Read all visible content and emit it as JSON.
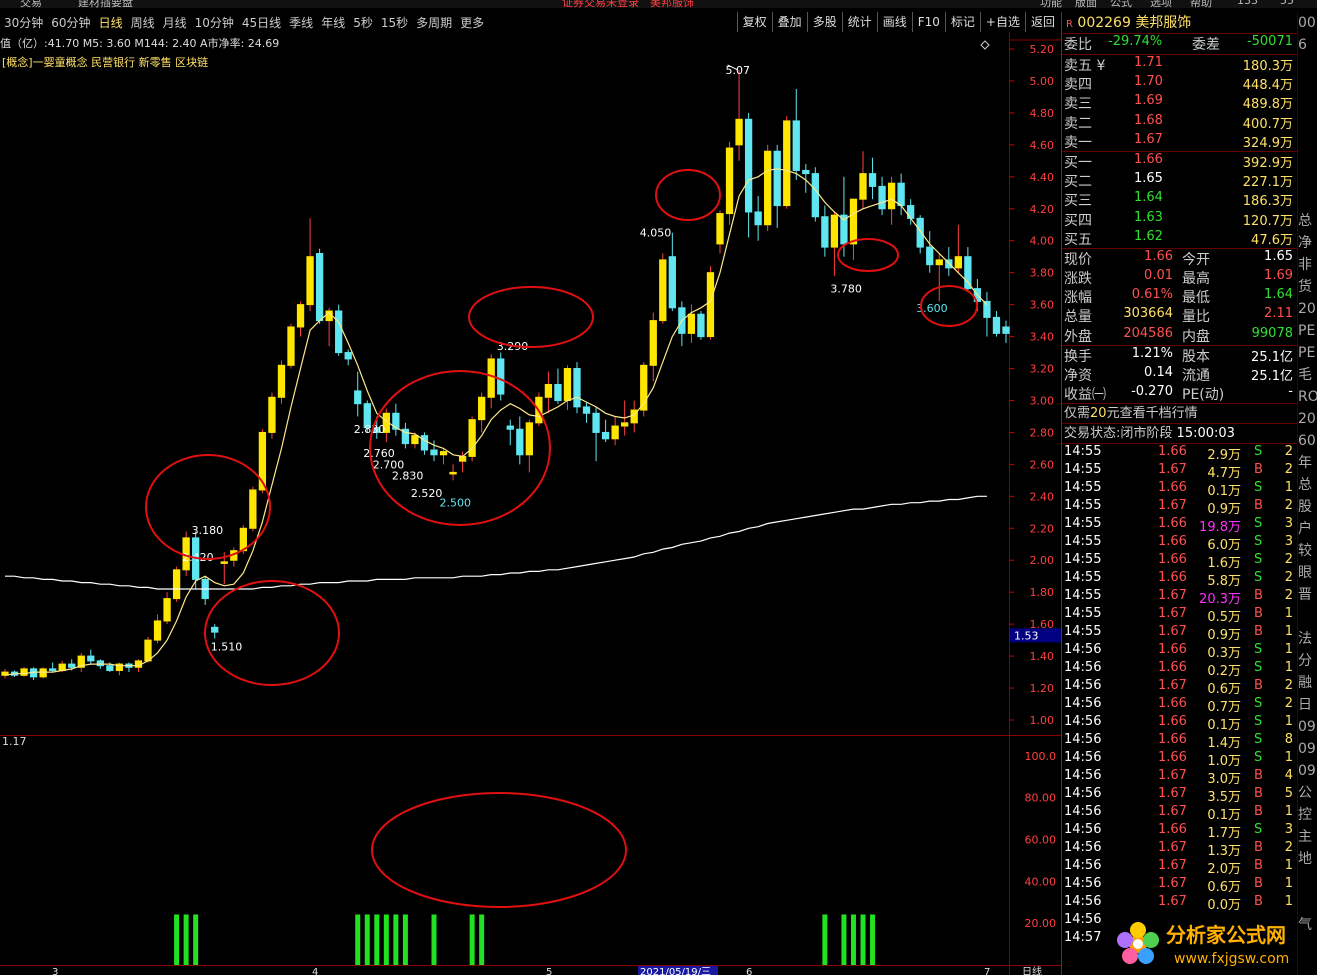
{
  "top_menu": [
    "交易",
    "建材插要盘",
    "证券交易未登录",
    "美邦服饰",
    "功能",
    "版面",
    "公式",
    "选项",
    "帮助",
    "133",
    "55"
  ],
  "periods": [
    "30分钟",
    "60分钟",
    "日线",
    "周线",
    "月线",
    "10分钟",
    "45日线",
    "季线",
    "年线",
    "5秒",
    "15秒",
    "多周期",
    "更多"
  ],
  "active_period": "日线",
  "tools": [
    "复权",
    "叠加",
    "多股",
    "统计",
    "画线",
    "F10",
    "标记",
    "+自选",
    "返回"
  ],
  "info_line": "值（亿）:41.70  M5: 3.60  M144: 2.40  A市净率: 24.69",
  "concepts": "[概念]一婴童概念 民营银行 新零售 区块链",
  "chart_data": {
    "type": "candlestick",
    "ylim": [
      0.95,
      5.3
    ],
    "yticks": [
      "5.20",
      "5.00",
      "4.80",
      "4.60",
      "4.40",
      "4.20",
      "4.00",
      "3.80",
      "3.60",
      "3.40",
      "3.20",
      "3.00",
      "2.80",
      "2.60",
      "2.40",
      "2.20",
      "2.00",
      "1.80",
      "1.60",
      "1.40",
      "1.20",
      "1.00"
    ],
    "current_price_tag": "1.53",
    "top_left_value": "1.17",
    "x_tick_labels": [
      "3",
      "4",
      "5",
      "2021/05/19/三",
      "6",
      "7",
      "日线"
    ],
    "candles": [
      [
        1.28,
        1.32,
        1.26,
        1.3
      ],
      [
        1.3,
        1.31,
        1.27,
        1.28
      ],
      [
        1.28,
        1.33,
        1.27,
        1.32
      ],
      [
        1.32,
        1.33,
        1.25,
        1.27
      ],
      [
        1.27,
        1.33,
        1.26,
        1.32
      ],
      [
        1.32,
        1.36,
        1.3,
        1.31
      ],
      [
        1.31,
        1.37,
        1.3,
        1.35
      ],
      [
        1.35,
        1.38,
        1.31,
        1.33
      ],
      [
        1.33,
        1.42,
        1.3,
        1.4
      ],
      [
        1.4,
        1.44,
        1.35,
        1.37
      ],
      [
        1.37,
        1.38,
        1.32,
        1.34
      ],
      [
        1.34,
        1.36,
        1.3,
        1.31
      ],
      [
        1.31,
        1.36,
        1.28,
        1.35
      ],
      [
        1.35,
        1.36,
        1.3,
        1.33
      ],
      [
        1.33,
        1.38,
        1.3,
        1.37
      ],
      [
        1.37,
        1.52,
        1.36,
        1.5
      ],
      [
        1.5,
        1.66,
        1.48,
        1.62
      ],
      [
        1.62,
        1.8,
        1.6,
        1.76
      ],
      [
        1.76,
        1.96,
        1.74,
        1.94
      ],
      [
        1.94,
        2.18,
        1.9,
        2.14
      ],
      [
        2.14,
        2.18,
        1.82,
        1.88
      ],
      [
        1.88,
        1.9,
        1.72,
        1.76
      ],
      [
        1.58,
        1.6,
        1.51,
        1.55
      ],
      [
        1.98,
        2.05,
        1.85,
        1.99
      ],
      [
        2.0,
        2.08,
        1.96,
        2.06
      ],
      [
        2.06,
        2.22,
        2.04,
        2.2
      ],
      [
        2.2,
        2.46,
        2.18,
        2.44
      ],
      [
        2.44,
        2.82,
        2.42,
        2.8
      ],
      [
        2.8,
        3.05,
        2.76,
        3.02
      ],
      [
        3.02,
        3.25,
        2.98,
        3.22
      ],
      [
        3.22,
        3.48,
        3.2,
        3.46
      ],
      [
        3.46,
        3.62,
        3.4,
        3.6
      ],
      [
        3.6,
        4.14,
        3.56,
        3.9
      ],
      [
        3.92,
        3.95,
        3.48,
        3.5
      ],
      [
        3.5,
        3.58,
        3.34,
        3.56
      ],
      [
        3.56,
        3.6,
        3.28,
        3.3
      ],
      [
        3.3,
        3.32,
        3.22,
        3.26
      ],
      [
        3.06,
        3.18,
        2.9,
        2.98
      ],
      [
        2.98,
        3.0,
        2.8,
        2.83
      ],
      [
        2.83,
        2.9,
        2.76,
        2.8
      ],
      [
        2.8,
        2.95,
        2.74,
        2.92
      ],
      [
        2.92,
        2.98,
        2.78,
        2.82
      ],
      [
        2.82,
        2.86,
        2.7,
        2.73
      ],
      [
        2.73,
        2.8,
        2.7,
        2.78
      ],
      [
        2.78,
        2.8,
        2.66,
        2.69
      ],
      [
        2.69,
        2.75,
        2.62,
        2.66
      ],
      [
        2.66,
        2.7,
        2.6,
        2.68
      ],
      [
        2.54,
        2.6,
        2.5,
        2.55
      ],
      [
        2.62,
        2.68,
        2.55,
        2.65
      ],
      [
        2.65,
        2.9,
        2.62,
        2.88
      ],
      [
        2.88,
        3.05,
        2.8,
        3.02
      ],
      [
        3.02,
        3.29,
        2.95,
        3.26
      ],
      [
        3.26,
        3.3,
        3.0,
        3.04
      ],
      [
        2.84,
        2.88,
        2.72,
        2.82
      ],
      [
        2.82,
        2.9,
        2.6,
        2.66
      ],
      [
        2.66,
        2.88,
        2.55,
        2.86
      ],
      [
        2.86,
        3.05,
        2.84,
        3.02
      ],
      [
        3.02,
        3.18,
        2.92,
        3.1
      ],
      [
        3.1,
        3.2,
        2.98,
        3.0
      ],
      [
        3.0,
        3.22,
        2.94,
        3.2
      ],
      [
        3.2,
        3.24,
        2.92,
        2.96
      ],
      [
        2.96,
        2.99,
        2.86,
        2.92
      ],
      [
        2.92,
        2.96,
        2.62,
        2.8
      ],
      [
        2.8,
        2.88,
        2.74,
        2.76
      ],
      [
        2.76,
        2.9,
        2.72,
        2.84
      ],
      [
        2.84,
        3.0,
        2.78,
        2.86
      ],
      [
        2.86,
        3.0,
        2.8,
        2.94
      ],
      [
        2.94,
        3.24,
        2.9,
        3.22
      ],
      [
        3.22,
        3.55,
        3.12,
        3.5
      ],
      [
        3.5,
        3.92,
        3.48,
        3.88
      ],
      [
        3.9,
        4.05,
        3.56,
        3.58
      ],
      [
        3.58,
        3.62,
        3.34,
        3.42
      ],
      [
        3.42,
        3.6,
        3.36,
        3.54
      ],
      [
        3.54,
        3.56,
        3.38,
        3.4
      ],
      [
        3.4,
        3.84,
        3.38,
        3.8
      ],
      [
        3.98,
        4.19,
        3.92,
        4.17
      ],
      [
        4.17,
        4.62,
        4.1,
        4.58
      ],
      [
        4.6,
        5.07,
        4.5,
        4.76
      ],
      [
        4.76,
        4.8,
        4.02,
        4.18
      ],
      [
        4.18,
        4.28,
        4.0,
        4.1
      ],
      [
        4.1,
        4.6,
        4.06,
        4.56
      ],
      [
        4.56,
        4.6,
        4.08,
        4.22
      ],
      [
        4.22,
        4.78,
        4.2,
        4.75
      ],
      [
        4.75,
        4.95,
        4.38,
        4.44
      ],
      [
        4.44,
        4.48,
        4.3,
        4.42
      ],
      [
        4.42,
        4.46,
        4.12,
        4.15
      ],
      [
        4.15,
        4.22,
        3.9,
        3.96
      ],
      [
        3.96,
        4.18,
        3.78,
        4.16
      ],
      [
        4.16,
        4.4,
        3.9,
        3.98
      ],
      [
        3.98,
        4.1,
        3.88,
        4.26
      ],
      [
        4.26,
        4.56,
        4.2,
        4.42
      ],
      [
        4.42,
        4.52,
        4.26,
        4.34
      ],
      [
        4.34,
        4.4,
        4.16,
        4.2
      ],
      [
        4.2,
        4.4,
        4.1,
        4.36
      ],
      [
        4.36,
        4.42,
        4.16,
        4.22
      ],
      [
        4.22,
        4.26,
        4.1,
        4.14
      ],
      [
        4.14,
        4.16,
        3.92,
        3.96
      ],
      [
        3.96,
        4.06,
        3.8,
        3.85
      ],
      [
        3.85,
        3.92,
        3.62,
        3.88
      ],
      [
        3.88,
        3.96,
        3.78,
        3.83
      ],
      [
        3.83,
        4.1,
        3.8,
        3.9
      ],
      [
        3.9,
        3.96,
        3.68,
        3.7
      ],
      [
        3.7,
        3.76,
        3.56,
        3.62
      ],
      [
        3.62,
        3.68,
        3.4,
        3.52
      ],
      [
        3.52,
        3.56,
        3.4,
        3.42
      ],
      [
        3.46,
        3.5,
        3.36,
        3.42
      ]
    ],
    "ma_short": [
      1.28,
      1.29,
      1.29,
      1.3,
      1.3,
      1.3,
      1.31,
      1.32,
      1.34,
      1.35,
      1.35,
      1.35,
      1.34,
      1.34,
      1.34,
      1.37,
      1.42,
      1.5,
      1.62,
      1.77,
      1.87,
      1.9,
      1.86,
      1.84,
      1.85,
      1.92,
      2.06,
      2.24,
      2.47,
      2.7,
      2.96,
      3.2,
      3.44,
      3.5,
      3.55,
      3.49,
      3.36,
      3.22,
      3.06,
      2.92,
      2.87,
      2.83,
      2.8,
      2.79,
      2.75,
      2.72,
      2.7,
      2.66,
      2.65,
      2.7,
      2.78,
      2.88,
      2.94,
      2.98,
      2.95,
      2.91,
      2.9,
      2.93,
      2.96,
      3.0,
      3.02,
      2.99,
      2.96,
      2.92,
      2.9,
      2.89,
      2.91,
      2.98,
      3.08,
      3.24,
      3.4,
      3.5,
      3.55,
      3.58,
      3.62,
      3.8,
      4.04,
      4.28,
      4.38,
      4.4,
      4.44,
      4.45,
      4.44,
      4.42,
      4.38,
      4.32,
      4.24,
      4.18,
      4.13,
      4.17,
      4.2,
      4.22,
      4.24,
      4.26,
      4.22,
      4.14,
      4.06,
      3.98,
      3.92,
      3.86,
      3.8,
      3.74,
      3.66,
      3.6
    ],
    "ma_long": [
      1.9,
      1.9,
      1.89,
      1.89,
      1.88,
      1.88,
      1.87,
      1.87,
      1.86,
      1.86,
      1.85,
      1.85,
      1.84,
      1.84,
      1.83,
      1.83,
      1.82,
      1.82,
      1.82,
      1.82,
      1.82,
      1.82,
      1.82,
      1.82,
      1.82,
      1.82,
      1.82,
      1.83,
      1.83,
      1.84,
      1.84,
      1.85,
      1.85,
      1.86,
      1.86,
      1.86,
      1.87,
      1.87,
      1.87,
      1.88,
      1.88,
      1.88,
      1.88,
      1.89,
      1.89,
      1.89,
      1.89,
      1.89,
      1.9,
      1.9,
      1.9,
      1.91,
      1.91,
      1.92,
      1.92,
      1.93,
      1.93,
      1.94,
      1.94,
      1.95,
      1.96,
      1.97,
      1.98,
      1.99,
      2.0,
      2.01,
      2.02,
      2.04,
      2.05,
      2.07,
      2.08,
      2.1,
      2.11,
      2.12,
      2.14,
      2.15,
      2.17,
      2.18,
      2.2,
      2.21,
      2.23,
      2.24,
      2.25,
      2.26,
      2.27,
      2.28,
      2.29,
      2.3,
      2.31,
      2.32,
      2.32,
      2.33,
      2.34,
      2.35,
      2.35,
      2.36,
      2.36,
      2.37,
      2.37,
      2.38,
      2.38,
      2.39,
      2.4,
      2.4
    ],
    "annotations": [
      {
        "label": "1.510",
        "candle": 22,
        "price": 1.46
      },
      {
        "label": "3.180",
        "candle": 20,
        "price": 2.19
      },
      {
        "label": "2.420",
        "candle": 19,
        "price": 2.02
      },
      {
        "label": "2.830",
        "candle": 37,
        "price": 2.82
      },
      {
        "label": "2.760",
        "candle": 38,
        "price": 2.67
      },
      {
        "label": "2.700",
        "candle": 39,
        "price": 2.6
      },
      {
        "label": "2.830",
        "candle": 41,
        "price": 2.53
      },
      {
        "label": "2.520",
        "candle": 43,
        "price": 2.42
      },
      {
        "label": "2.500",
        "candle": 46,
        "price": 2.36
      },
      {
        "label": "3.290",
        "candle": 52,
        "price": 3.34
      },
      {
        "label": "4.050",
        "candle": 67,
        "price": 4.05
      },
      {
        "label": "5.07",
        "candle": 76,
        "price": 5.07
      },
      {
        "label": "3.780",
        "candle": 87,
        "price": 3.7
      },
      {
        "label": "3.600",
        "candle": 96,
        "price": 3.58
      }
    ],
    "circles": [
      {
        "cx": 208,
        "cy": 507,
        "rx": 62,
        "ry": 52
      },
      {
        "cx": 272,
        "cy": 633,
        "rx": 67,
        "ry": 52
      },
      {
        "cx": 460,
        "cy": 448,
        "rx": 90,
        "ry": 77
      },
      {
        "cx": 531,
        "cy": 317,
        "rx": 62,
        "ry": 30
      },
      {
        "cx": 688,
        "cy": 195,
        "rx": 32,
        "ry": 25
      },
      {
        "cx": 868,
        "cy": 255,
        "rx": 30,
        "ry": 16
      },
      {
        "cx": 949,
        "cy": 306,
        "rx": 28,
        "ry": 20
      }
    ],
    "sub_yticks": [
      "100.0",
      "80.00",
      "60.00",
      "40.00",
      "20.00"
    ],
    "sub_ylim": [
      0,
      110
    ],
    "sub_bars": [
      {
        "candle": 18,
        "value": 50
      },
      {
        "candle": 19,
        "value": 50
      },
      {
        "candle": 20,
        "value": 50
      },
      {
        "candle": 37,
        "value": 50
      },
      {
        "candle": 38,
        "value": 50
      },
      {
        "candle": 39,
        "value": 50
      },
      {
        "candle": 40,
        "value": 50
      },
      {
        "candle": 41,
        "value": 50
      },
      {
        "candle": 42,
        "value": 50
      },
      {
        "candle": 45,
        "value": 50
      },
      {
        "candle": 49,
        "value": 50
      },
      {
        "candle": 50,
        "value": 50
      },
      {
        "candle": 86,
        "value": 50
      },
      {
        "candle": 88,
        "value": 50
      },
      {
        "candle": 89,
        "value": 50
      },
      {
        "candle": 90,
        "value": 50
      },
      {
        "candle": 91,
        "value": 50
      }
    ],
    "sub_circle": {
      "cx": 499,
      "cy": 850,
      "rx": 127,
      "ry": 57
    }
  },
  "stock": {
    "marker": "R",
    "code": "002269",
    "name": "美邦服饰"
  },
  "committee": {
    "label1": "委比",
    "val1": "-29.74%",
    "label2": "委差",
    "val2": "-50071"
  },
  "asks": [
    {
      "label": "卖五 ¥",
      "price": "1.71",
      "vol": "180.3万"
    },
    {
      "label": "卖四",
      "price": "1.70",
      "vol": "448.4万"
    },
    {
      "label": "卖三",
      "price": "1.69",
      "vol": "489.8万"
    },
    {
      "label": "卖二",
      "price": "1.68",
      "vol": "400.7万"
    },
    {
      "label": "卖一",
      "price": "1.67",
      "vol": "324.9万"
    }
  ],
  "bids": [
    {
      "label": "买一",
      "price": "1.66",
      "vol": "392.9万",
      "pc": "red"
    },
    {
      "label": "买二",
      "price": "1.65",
      "vol": "227.1万",
      "pc": "wht"
    },
    {
      "label": "买三",
      "price": "1.64",
      "vol": "186.3万",
      "pc": "grn"
    },
    {
      "label": "买四",
      "price": "1.63",
      "vol": "120.7万",
      "pc": "grn"
    },
    {
      "label": "买五",
      "price": "1.62",
      "vol": "47.6万",
      "pc": "grn"
    }
  ],
  "quote": [
    {
      "l1": "现价",
      "v1": "1.66",
      "c1": "red",
      "l2": "今开",
      "v2": "1.65",
      "c2": "wht"
    },
    {
      "l1": "涨跌",
      "v1": "0.01",
      "c1": "red",
      "l2": "最高",
      "v2": "1.69",
      "c2": "red"
    },
    {
      "l1": "涨幅",
      "v1": "0.61%",
      "c1": "red",
      "l2": "最低",
      "v2": "1.64",
      "c2": "grn"
    },
    {
      "l1": "总量",
      "v1": "303664",
      "c1": "ylw",
      "l2": "量比",
      "v2": "2.11",
      "c2": "red"
    },
    {
      "l1": "外盘",
      "v1": "204586",
      "c1": "red",
      "l2": "内盘",
      "v2": "99078",
      "c2": "grn"
    }
  ],
  "quote2": [
    {
      "l1": "换手",
      "v1": "1.21%",
      "l2": "股本",
      "v2": "25.1亿"
    },
    {
      "l1": "净资",
      "v1": "0.14",
      "l2": "流通",
      "v2": "25.1亿"
    },
    {
      "l1": "收益㈠",
      "v1": "-0.270",
      "l2": "PE(动)",
      "v2": "-"
    }
  ],
  "promo": {
    "prefix": "仅需",
    "num": "20",
    "suffix": "元查看千档行情"
  },
  "trade_status": {
    "label": "交易状态:",
    "value": "闭市阶段",
    "time": "15:00:03"
  },
  "ticks": [
    [
      "14:55",
      "1.66",
      "2.9万",
      "S",
      "2"
    ],
    [
      "14:55",
      "1.67",
      "4.7万",
      "B",
      "2"
    ],
    [
      "14:55",
      "1.66",
      "0.1万",
      "S",
      "1"
    ],
    [
      "14:55",
      "1.67",
      "0.9万",
      "B",
      "2"
    ],
    [
      "14:55",
      "1.66",
      "19.8万",
      "S",
      "3"
    ],
    [
      "14:55",
      "1.66",
      "6.0万",
      "S",
      "3"
    ],
    [
      "14:55",
      "1.66",
      "1.6万",
      "S",
      "2"
    ],
    [
      "14:55",
      "1.66",
      "5.8万",
      "S",
      "2"
    ],
    [
      "14:55",
      "1.67",
      "20.3万",
      "B",
      "2"
    ],
    [
      "14:55",
      "1.67",
      "0.5万",
      "B",
      "1"
    ],
    [
      "14:55",
      "1.67",
      "0.9万",
      "B",
      "1"
    ],
    [
      "14:56",
      "1.66",
      "0.3万",
      "S",
      "1"
    ],
    [
      "14:56",
      "1.66",
      "0.2万",
      "S",
      "1"
    ],
    [
      "14:56",
      "1.67",
      "0.6万",
      "B",
      "2"
    ],
    [
      "14:56",
      "1.66",
      "0.7万",
      "S",
      "2"
    ],
    [
      "14:56",
      "1.66",
      "0.1万",
      "S",
      "1"
    ],
    [
      "14:56",
      "1.66",
      "1.4万",
      "S",
      "8"
    ],
    [
      "14:56",
      "1.66",
      "1.0万",
      "S",
      "1"
    ],
    [
      "14:56",
      "1.67",
      "3.0万",
      "B",
      "4"
    ],
    [
      "14:56",
      "1.67",
      "3.5万",
      "B",
      "5"
    ],
    [
      "14:56",
      "1.67",
      "0.1万",
      "B",
      "1"
    ],
    [
      "14:56",
      "1.66",
      "1.7万",
      "S",
      "3"
    ],
    [
      "14:56",
      "1.67",
      "1.3万",
      "B",
      "2"
    ],
    [
      "14:56",
      "1.67",
      "2.0万",
      "B",
      "1"
    ],
    [
      "14:56",
      "1.67",
      "0.6万",
      "B",
      "1"
    ],
    [
      "14:56",
      "1.67",
      "0.0万",
      "B",
      "1"
    ],
    [
      "14:56",
      "",
      "",
      "",
      ""
    ],
    [
      "14:57",
      "",
      "",
      "",
      ""
    ]
  ],
  "far_right": [
    "00",
    "6",
    "",
    "",
    "",
    "",
    "",
    "",
    "",
    "总",
    "净",
    "非",
    "货",
    "20",
    "PE",
    "PE",
    "毛",
    "RO",
    "20",
    "60",
    "年",
    "总",
    "股",
    "户",
    "较",
    "眼",
    "晋",
    "",
    "法",
    "分",
    "融",
    "日",
    "09",
    "09",
    "09",
    "公",
    "控",
    "主",
    "地",
    "",
    "",
    "气"
  ],
  "watermark": {
    "title": "分析家公式网",
    "url": "www.fxjgsw.com"
  },
  "colors": {
    "up": "#ffe600",
    "down": "#5fe6f0",
    "ma_short": "#ffe88a",
    "ma_long": "#ffffff",
    "circle": "#e01010",
    "sub_bar": "#22e022",
    "grid": "#8b0000"
  }
}
